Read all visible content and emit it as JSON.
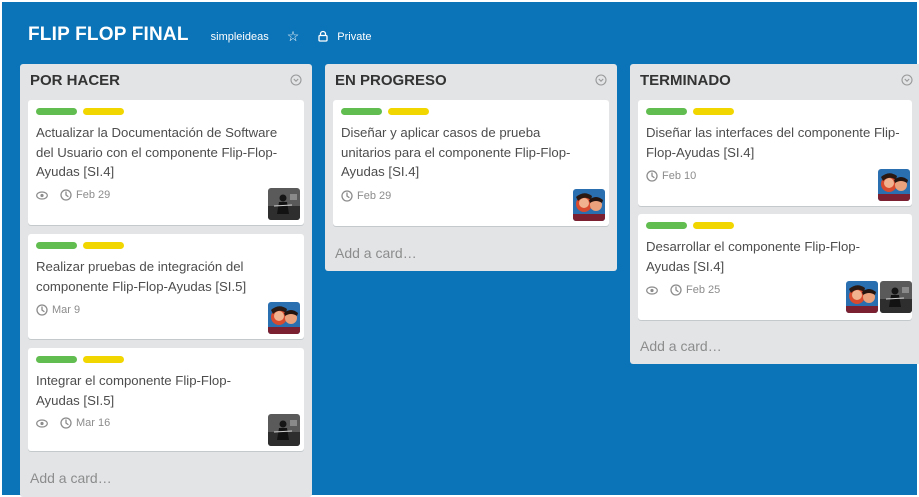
{
  "board": {
    "title": "FLIP FLOP FINAL",
    "team": "simpleideas",
    "privacy": "Private"
  },
  "colors": {
    "board_bg": "#0b73b7",
    "list_bg": "#e2e4e6",
    "label_green": "#61bd4f",
    "label_yellow": "#f2d600"
  },
  "lists": [
    {
      "title": "POR HACER",
      "add_card": "Add a card…",
      "cards": [
        {
          "title": "Actualizar la Documentación de Software del Usuario con el componente Flip-Flop-Ayudas [SI.4]",
          "due": "Feb 29",
          "watching": true
        },
        {
          "title": "Realizar pruebas de integración del componente Flip-Flop-Ayudas [SI.5]",
          "due": "Mar 9",
          "watching": false
        },
        {
          "title": "Integrar el componente Flip-Flop-Ayudas [SI.5]",
          "due": "Mar 16",
          "watching": true
        }
      ]
    },
    {
      "title": "EN PROGRESO",
      "add_card": "Add a card…",
      "cards": [
        {
          "title": "Diseñar y aplicar casos de prueba unitarios para el componente Flip-Flop-Ayudas [SI.4]",
          "due": "Feb 29",
          "watching": false
        }
      ]
    },
    {
      "title": "TERMINADO",
      "add_card": "Add a card…",
      "cards": [
        {
          "title": "Diseñar las interfaces del componente Flip-Flop-Ayudas [SI.4]",
          "due": "Feb 10",
          "watching": false
        },
        {
          "title": "Desarrollar el componente Flip-Flop-Ayudas [SI.4]",
          "due": "Feb 25",
          "watching": true
        }
      ]
    }
  ]
}
